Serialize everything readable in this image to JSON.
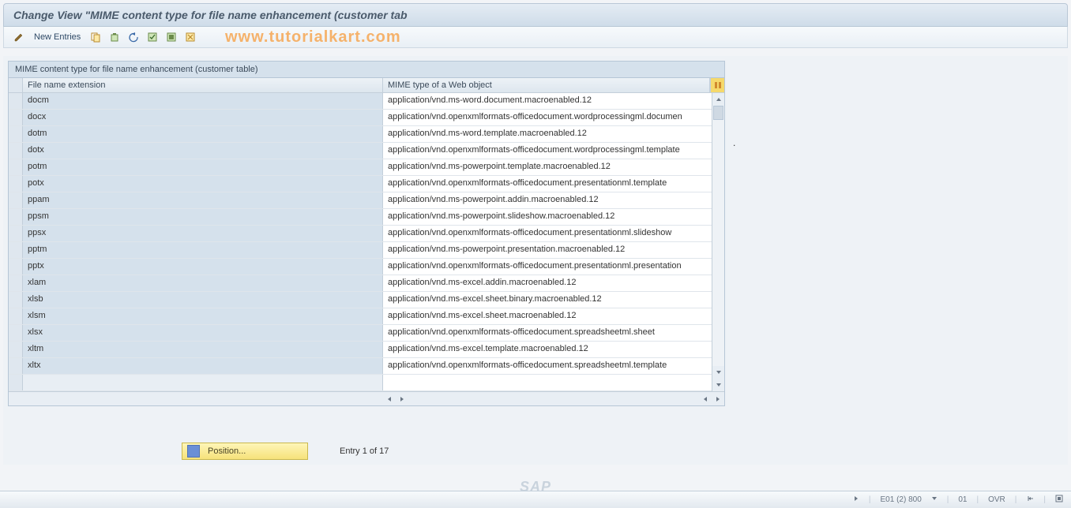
{
  "title": "Change View \"MIME content type for file name enhancement (customer tab",
  "toolbar": {
    "new_entries": "New Entries"
  },
  "watermark": "www.tutorialkart.com",
  "panel": {
    "header": "MIME content type for file name enhancement (customer table)",
    "columns": {
      "ext": "File name extension",
      "mime": "MIME type of a Web object"
    },
    "rows": [
      {
        "ext": "docm",
        "mime": "application/vnd.ms-word.document.macroenabled.12"
      },
      {
        "ext": "docx",
        "mime": "application/vnd.openxmlformats-officedocument.wordprocessingml.documen"
      },
      {
        "ext": "dotm",
        "mime": "application/vnd.ms-word.template.macroenabled.12"
      },
      {
        "ext": "dotx",
        "mime": "application/vnd.openxmlformats-officedocument.wordprocessingml.template"
      },
      {
        "ext": "potm",
        "mime": "application/vnd.ms-powerpoint.template.macroenabled.12"
      },
      {
        "ext": "potx",
        "mime": "application/vnd.openxmlformats-officedocument.presentationml.template"
      },
      {
        "ext": "ppam",
        "mime": "application/vnd.ms-powerpoint.addin.macroenabled.12"
      },
      {
        "ext": "ppsm",
        "mime": "application/vnd.ms-powerpoint.slideshow.macroenabled.12"
      },
      {
        "ext": "ppsx",
        "mime": "application/vnd.openxmlformats-officedocument.presentationml.slideshow"
      },
      {
        "ext": "pptm",
        "mime": "application/vnd.ms-powerpoint.presentation.macroenabled.12"
      },
      {
        "ext": "pptx",
        "mime": "application/vnd.openxmlformats-officedocument.presentationml.presentation"
      },
      {
        "ext": "xlam",
        "mime": "application/vnd.ms-excel.addin.macroenabled.12"
      },
      {
        "ext": "xlsb",
        "mime": "application/vnd.ms-excel.sheet.binary.macroenabled.12"
      },
      {
        "ext": "xlsm",
        "mime": "application/vnd.ms-excel.sheet.macroenabled.12"
      },
      {
        "ext": "xlsx",
        "mime": "application/vnd.openxmlformats-officedocument.spreadsheetml.sheet"
      },
      {
        "ext": "xltm",
        "mime": "application/vnd.ms-excel.template.macroenabled.12"
      },
      {
        "ext": "xltx",
        "mime": "application/vnd.openxmlformats-officedocument.spreadsheetml.template"
      },
      {
        "ext": "",
        "mime": ""
      }
    ]
  },
  "position_button": "Position...",
  "entry_counter": "Entry 1 of 17",
  "statusbar": {
    "system": "E01 (2) 800",
    "client": "01",
    "mode": "OVR"
  }
}
